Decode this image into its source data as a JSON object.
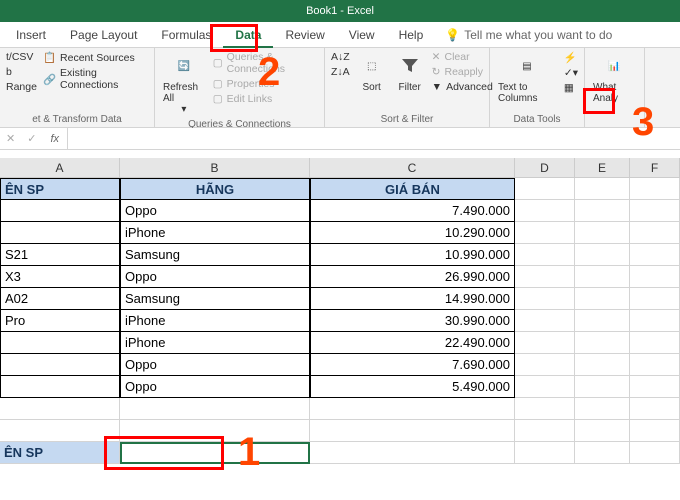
{
  "app": {
    "title": "Book1 - Excel"
  },
  "tabs": {
    "items": [
      "Insert",
      "Page Layout",
      "Formulas",
      "Data",
      "Review",
      "View",
      "Help"
    ],
    "active": "Data",
    "tell_me": "Tell me what you want to do"
  },
  "ribbon": {
    "g1": {
      "label": "et & Transform Data",
      "btn1": "t/CSV",
      "btn2": "b",
      "btn3": "Range",
      "rs": "Recent Sources",
      "ec": "Existing Connections"
    },
    "g2": {
      "label": "Queries & Connections",
      "refresh": "Refresh All",
      "qc": "Queries & Connections",
      "prop": "Properties",
      "el": "Edit Links"
    },
    "g3": {
      "label": "Sort & Filter",
      "sort": "Sort",
      "filter": "Filter",
      "clear": "Clear",
      "reapply": "Reapply",
      "adv": "Advanced"
    },
    "g4": {
      "label": "Data Tools",
      "ttc": "Text to Columns"
    },
    "g5": {
      "what": "What Analy"
    }
  },
  "formula_bar": {
    "fx": "fx",
    "value": ""
  },
  "columns": [
    "A",
    "B",
    "C",
    "D",
    "E",
    "F"
  ],
  "headers": {
    "col_a": "ÊN SP",
    "col_b": "HÃNG",
    "col_c": "GIÁ BÁN"
  },
  "rows": [
    {
      "a": "",
      "b": "Oppo",
      "c": "7.490.000"
    },
    {
      "a": "",
      "b": "iPhone",
      "c": "10.290.000"
    },
    {
      "a": "S21",
      "b": "Samsung",
      "c": "10.990.000"
    },
    {
      "a": "X3",
      "b": "Oppo",
      "c": "26.990.000"
    },
    {
      "a": "A02",
      "b": "Samsung",
      "c": "14.990.000"
    },
    {
      "a": "Pro",
      "b": "iPhone",
      "c": "30.990.000"
    },
    {
      "a": "",
      "b": "iPhone",
      "c": "22.490.000"
    },
    {
      "a": "",
      "b": "Oppo",
      "c": "7.690.000"
    },
    {
      "a": "",
      "b": "Oppo",
      "c": "5.490.000"
    }
  ],
  "footer_header": {
    "col_a": "ÊN SP"
  },
  "annotations": {
    "n1": "1",
    "n2": "2",
    "n3": "3"
  }
}
